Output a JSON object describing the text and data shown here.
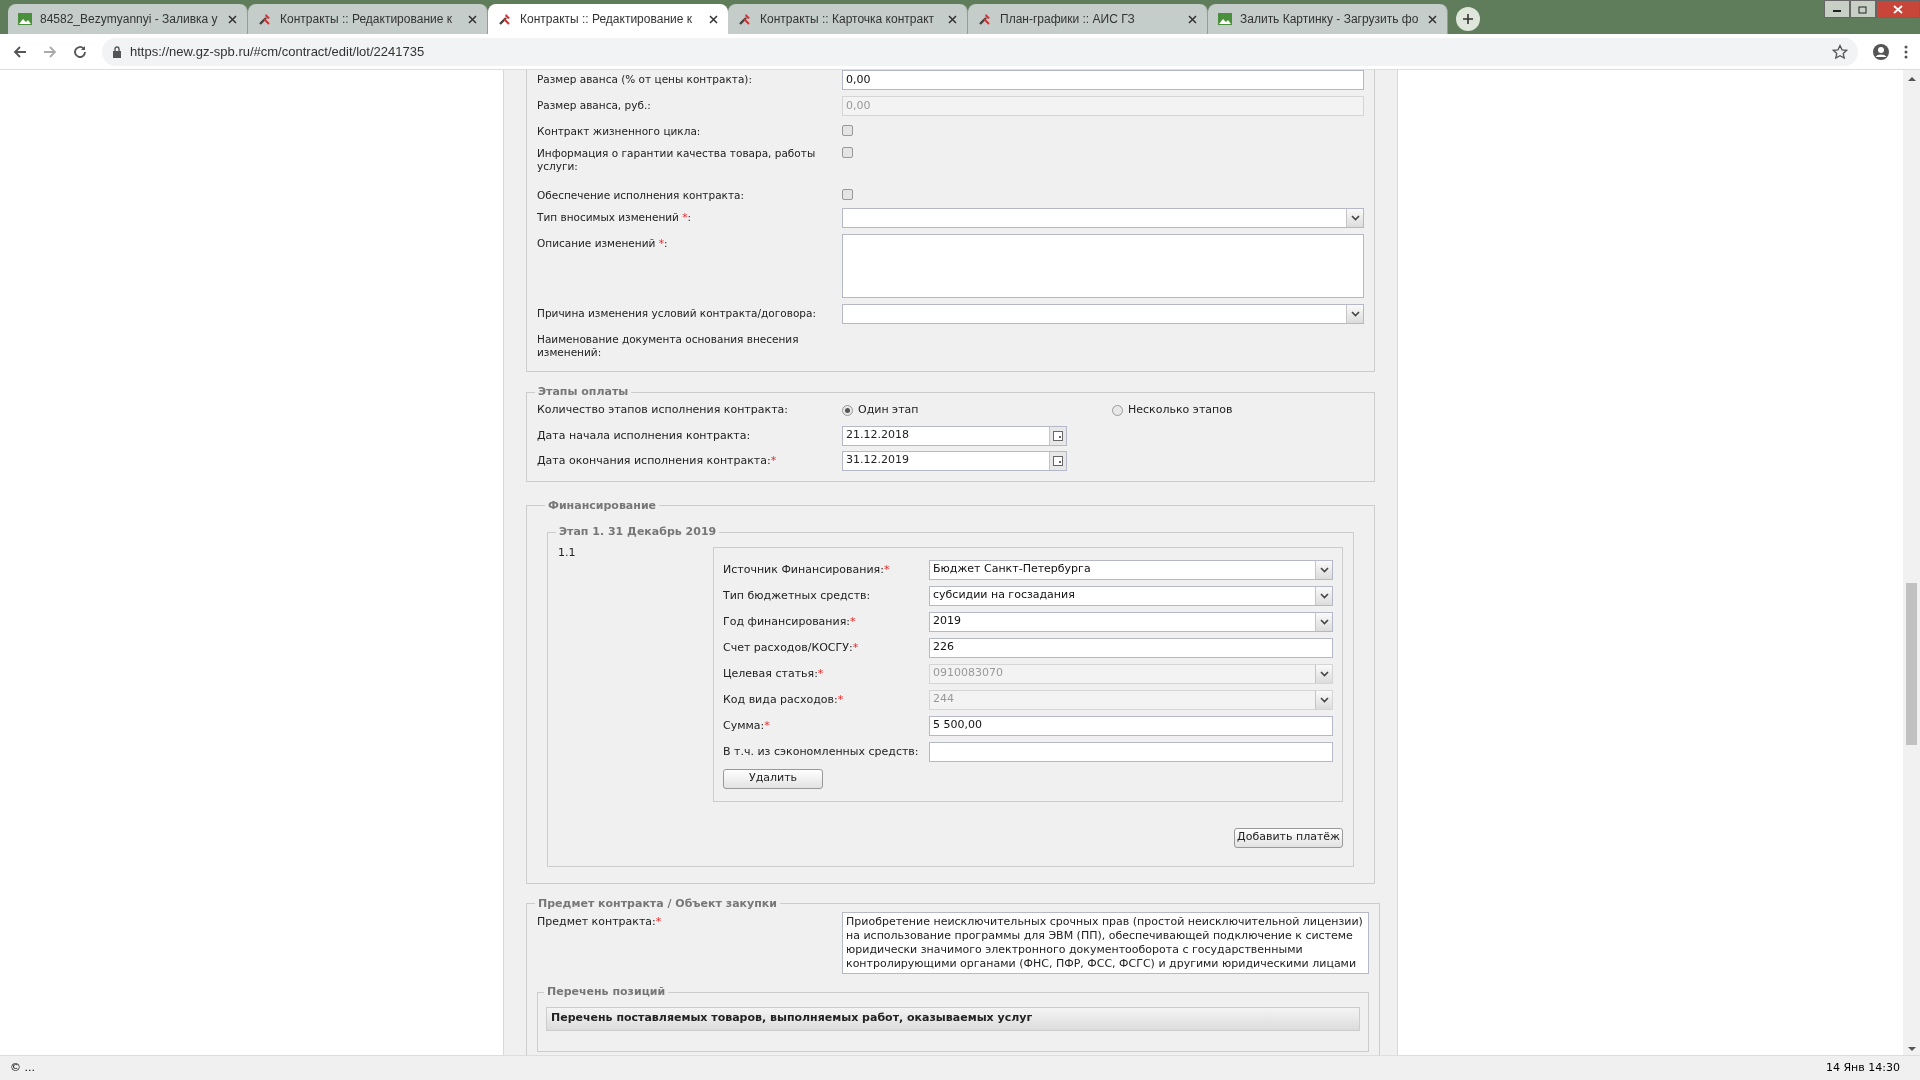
{
  "browser": {
    "tabs": [
      {
        "title": "84582_Bezymyannyi - Заливка у",
        "kind": "image",
        "selected": false
      },
      {
        "title": "Контракты :: Редактирование к",
        "kind": "tool",
        "selected": false
      },
      {
        "title": "Контракты :: Редактирование к",
        "kind": "tool",
        "selected": true
      },
      {
        "title": "Контракты :: Карточка контракт",
        "kind": "tool",
        "selected": false
      },
      {
        "title": "План-графики :: АИС ГЗ",
        "kind": "tool",
        "selected": false
      },
      {
        "title": "Залить Картинку - Загрузить фо",
        "kind": "image",
        "selected": false
      }
    ],
    "url": "https://new.gz-spb.ru/#cm/contract/edit/lot/2241735"
  },
  "general": {
    "fields": [
      {
        "kind": "input",
        "label": "Размер аванса (% от цены контракта):",
        "value": "0,00",
        "disabled": false
      },
      {
        "kind": "input",
        "label": "Размер аванса, руб.:",
        "value": "0,00",
        "disabled": true
      },
      {
        "kind": "checkbox",
        "label": "Контракт жизненного цикла:",
        "checked": false
      },
      {
        "kind": "checkbox",
        "label": "Информация о гарантии качества товара, работы услуги:",
        "checked": false
      },
      {
        "kind": "checkbox",
        "label": "Обеспечение исполнения контракта:",
        "checked": false
      },
      {
        "kind": "select",
        "label": "Тип вносимых изменений ",
        "required_mark": "*",
        "label_end": ":"
      },
      {
        "kind": "textarea",
        "label": "Описание изменений ",
        "required_mark": "*",
        "label_end": ":"
      },
      {
        "kind": "select",
        "label": "Причина изменения условий контракта/договора:"
      },
      {
        "kind": "text",
        "label": "Наименование документа основания внесения изменений:"
      }
    ]
  },
  "payment_stages": {
    "legend": "Этапы оплаты",
    "count_label": "Количество этапов исполнения контракта:",
    "options": [
      {
        "label": "Один этап",
        "selected": true
      },
      {
        "label": "Несколько этапов",
        "selected": false
      }
    ],
    "dates": [
      {
        "label": "Дата начала исполнения контракта:",
        "value": "21.12.2018"
      },
      {
        "label": "Дата окончания исполнения контракта:",
        "required_mark": "*",
        "value": "31.12.2019"
      }
    ]
  },
  "financing": {
    "legend": "Финансирование",
    "stage": {
      "legend": "Этап 1. 31 Декабрь 2019",
      "number": "1.1",
      "fields": [
        {
          "kind": "select",
          "label": "Источник Финансирования:",
          "required_mark": "*",
          "value": "Бюджет Санкт-Петербурга",
          "disabled": false
        },
        {
          "kind": "select",
          "label": "Тип бюджетных средств:",
          "value": "субсидии на госзадания",
          "disabled": false
        },
        {
          "kind": "select",
          "label": "Год финансирования:",
          "required_mark": "*",
          "value": "2019",
          "disabled": false
        },
        {
          "kind": "input",
          "label": "Счет расходов/КОСГУ:",
          "required_mark": "*",
          "value": "226",
          "disabled": false
        },
        {
          "kind": "select",
          "label": "Целевая статья:",
          "required_mark": "*",
          "value": "0910083070",
          "disabled": true
        },
        {
          "kind": "select",
          "label": "Код вида расходов:",
          "required_mark": "*",
          "value": "244",
          "disabled": true
        },
        {
          "kind": "input",
          "label": "Сумма:",
          "required_mark": "*",
          "value": "5 500,00",
          "disabled": false
        },
        {
          "kind": "input",
          "label": "В т.ч. из сэкономленных средств:",
          "disabled": false
        }
      ],
      "delete_button": "Удалить",
      "add_button": "Добавить платёж"
    }
  },
  "subject": {
    "legend": "Предмет контракта / Объект закупки",
    "label": "Предмет контракта:",
    "required_mark": "*",
    "value": "Приобретение неисключительных срочных прав (простой неисключительной лицензии) на использование программы для ЭВМ (ПП), обеспечивающей подключение к системе юридически значимого электронного документооборота с государственными контролирующими органами (ФНС, ПФР, ФСС, ФСГС) и другими юридическими лицами",
    "positions": {
      "legend": "Перечень позиций",
      "header": "Перечень поставляемых товаров, выполняемых работ, оказываемых услуг"
    }
  },
  "status_bar": {
    "left": "© ...",
    "right": "14 Янв 14:30"
  }
}
